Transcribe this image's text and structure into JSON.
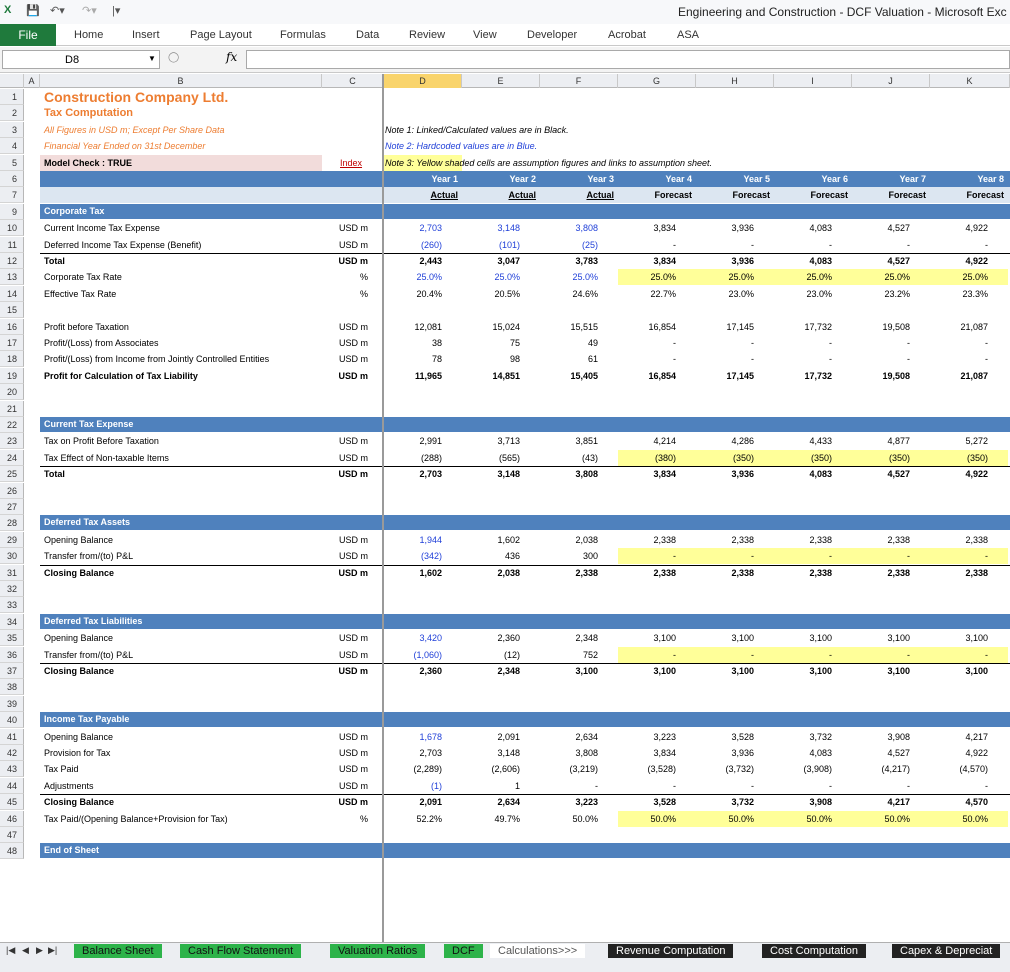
{
  "window": {
    "title": "Engineering and Construction - DCF Valuation - Microsoft Exc"
  },
  "ribbon": {
    "file": "File",
    "tabs": [
      "Home",
      "Insert",
      "Page Layout",
      "Formulas",
      "Data",
      "Review",
      "View",
      "Developer",
      "Acrobat",
      "ASA"
    ]
  },
  "formula_bar": {
    "name_box": "D8",
    "fx": "fx",
    "value": ""
  },
  "columns": [
    "A",
    "B",
    "C",
    "D",
    "E",
    "F",
    "G",
    "H",
    "I",
    "J",
    "K"
  ],
  "selected_column": "D",
  "header": {
    "company": "Construction Company Ltd.",
    "subtitle": "Tax Computation",
    "note_units": "All Figures in USD m; Except Per Share Data",
    "note_year": "Financial Year Ended on 31st December",
    "model_check": "Model Check : TRUE",
    "index_link": "Index",
    "note1": "Note 1: Linked/Calculated values are in Black.",
    "note2": "Note 2: Hardcoded values are in Blue.",
    "note3": "Note 3: Yellow shaded cells are assumption figures and links to assumption sheet."
  },
  "years": [
    "Year 1",
    "Year 2",
    "Year 3",
    "Year 4",
    "Year 5",
    "Year 6",
    "Year 7",
    "Year 8"
  ],
  "periods": [
    "Actual",
    "Actual",
    "Actual",
    "Forecast",
    "Forecast",
    "Forecast",
    "Forecast",
    "Forecast"
  ],
  "sections": {
    "s9": "Corporate Tax",
    "s22": "Current Tax Expense",
    "s28": "Deferred Tax Assets",
    "s34": "Deferred Tax Liabilities",
    "s40": "Income Tax Payable",
    "s48": "End of Sheet"
  },
  "rows": {
    "r10": {
      "label": "Current Income Tax Expense",
      "unit": "USD m",
      "v": [
        "2,703",
        "3,148",
        "3,808",
        "3,834",
        "3,936",
        "4,083",
        "4,527",
        "4,922"
      ]
    },
    "r11": {
      "label": "Deferred Income Tax Expense (Benefit)",
      "unit": "USD m",
      "v": [
        "(260)",
        "(101)",
        "(25)",
        "-",
        "-",
        "-",
        "-",
        "-"
      ]
    },
    "r12": {
      "label": "Total",
      "unit": "USD m",
      "v": [
        "2,443",
        "3,047",
        "3,783",
        "3,834",
        "3,936",
        "4,083",
        "4,527",
        "4,922"
      ]
    },
    "r13": {
      "label": "Corporate Tax Rate",
      "unit": "%",
      "v": [
        "25.0%",
        "25.0%",
        "25.0%",
        "25.0%",
        "25.0%",
        "25.0%",
        "25.0%",
        "25.0%"
      ]
    },
    "r14": {
      "label": "Effective Tax Rate",
      "unit": "%",
      "v": [
        "20.4%",
        "20.5%",
        "24.6%",
        "22.7%",
        "23.0%",
        "23.0%",
        "23.2%",
        "23.3%"
      ]
    },
    "r16": {
      "label": "Profit before Taxation",
      "unit": "USD m",
      "v": [
        "12,081",
        "15,024",
        "15,515",
        "16,854",
        "17,145",
        "17,732",
        "19,508",
        "21,087"
      ]
    },
    "r17": {
      "label": "Profit/(Loss) from Associates",
      "unit": "USD m",
      "v": [
        "38",
        "75",
        "49",
        "-",
        "-",
        "-",
        "-",
        "-"
      ]
    },
    "r18": {
      "label": "Profit/(Loss) from Income from Jointly Controlled Entities",
      "unit": "USD m",
      "v": [
        "78",
        "98",
        "61",
        "-",
        "-",
        "-",
        "-",
        "-"
      ]
    },
    "r19": {
      "label": "Profit for Calculation of Tax Liability",
      "unit": "USD m",
      "v": [
        "11,965",
        "14,851",
        "15,405",
        "16,854",
        "17,145",
        "17,732",
        "19,508",
        "21,087"
      ]
    },
    "r23": {
      "label": "Tax on Profit Before Taxation",
      "unit": "USD m",
      "v": [
        "2,991",
        "3,713",
        "3,851",
        "4,214",
        "4,286",
        "4,433",
        "4,877",
        "5,272"
      ]
    },
    "r24": {
      "label": "Tax Effect of Non-taxable Items",
      "unit": "USD m",
      "v": [
        "(288)",
        "(565)",
        "(43)",
        "(380)",
        "(350)",
        "(350)",
        "(350)",
        "(350)"
      ]
    },
    "r25": {
      "label": "Total",
      "unit": "USD m",
      "v": [
        "2,703",
        "3,148",
        "3,808",
        "3,834",
        "3,936",
        "4,083",
        "4,527",
        "4,922"
      ]
    },
    "r29": {
      "label": "Opening Balance",
      "unit": "USD m",
      "v": [
        "1,944",
        "1,602",
        "2,038",
        "2,338",
        "2,338",
        "2,338",
        "2,338",
        "2,338"
      ]
    },
    "r30": {
      "label": "Transfer from/(to) P&L",
      "unit": "USD m",
      "v": [
        "(342)",
        "436",
        "300",
        "-",
        "-",
        "-",
        "-",
        "-"
      ]
    },
    "r31": {
      "label": "Closing Balance",
      "unit": "USD m",
      "v": [
        "1,602",
        "2,038",
        "2,338",
        "2,338",
        "2,338",
        "2,338",
        "2,338",
        "2,338"
      ]
    },
    "r35": {
      "label": "Opening Balance",
      "unit": "USD m",
      "v": [
        "3,420",
        "2,360",
        "2,348",
        "3,100",
        "3,100",
        "3,100",
        "3,100",
        "3,100"
      ]
    },
    "r36": {
      "label": "Transfer from/(to) P&L",
      "unit": "USD m",
      "v": [
        "(1,060)",
        "(12)",
        "752",
        "-",
        "-",
        "-",
        "-",
        "-"
      ]
    },
    "r37": {
      "label": "Closing Balance",
      "unit": "USD m",
      "v": [
        "2,360",
        "2,348",
        "3,100",
        "3,100",
        "3,100",
        "3,100",
        "3,100",
        "3,100"
      ]
    },
    "r41": {
      "label": "Opening Balance",
      "unit": "USD m",
      "v": [
        "1,678",
        "2,091",
        "2,634",
        "3,223",
        "3,528",
        "3,732",
        "3,908",
        "4,217"
      ]
    },
    "r42": {
      "label": "Provision for Tax",
      "unit": "USD m",
      "v": [
        "2,703",
        "3,148",
        "3,808",
        "3,834",
        "3,936",
        "4,083",
        "4,527",
        "4,922"
      ]
    },
    "r43": {
      "label": "Tax Paid",
      "unit": "USD m",
      "v": [
        "(2,289)",
        "(2,606)",
        "(3,219)",
        "(3,528)",
        "(3,732)",
        "(3,908)",
        "(4,217)",
        "(4,570)"
      ]
    },
    "r44": {
      "label": "Adjustments",
      "unit": "USD m",
      "v": [
        "(1)",
        "1",
        "-",
        "-",
        "-",
        "-",
        "-",
        "-"
      ]
    },
    "r45": {
      "label": "Closing Balance",
      "unit": "USD m",
      "v": [
        "2,091",
        "2,634",
        "3,223",
        "3,528",
        "3,732",
        "3,908",
        "4,217",
        "4,570"
      ]
    },
    "r46": {
      "label": "Tax Paid/(Opening Balance+Provision for Tax)",
      "unit": "%",
      "v": [
        "52.2%",
        "49.7%",
        "50.0%",
        "50.0%",
        "50.0%",
        "50.0%",
        "50.0%",
        "50.0%"
      ]
    }
  },
  "sheet_tabs": [
    "Balance Sheet",
    "Cash Flow Statement",
    "Valuation Ratios",
    "DCF",
    "Calculations>>>",
    "Revenue Computation",
    "Cost Computation",
    "Capex & Depreciat"
  ],
  "colors": {
    "section_band": "#4f81bd",
    "assumption": "#ffff99",
    "hardcoded": "#1f3fd8",
    "title": "#ed7d31",
    "excel_green": "#1f7a3c"
  }
}
